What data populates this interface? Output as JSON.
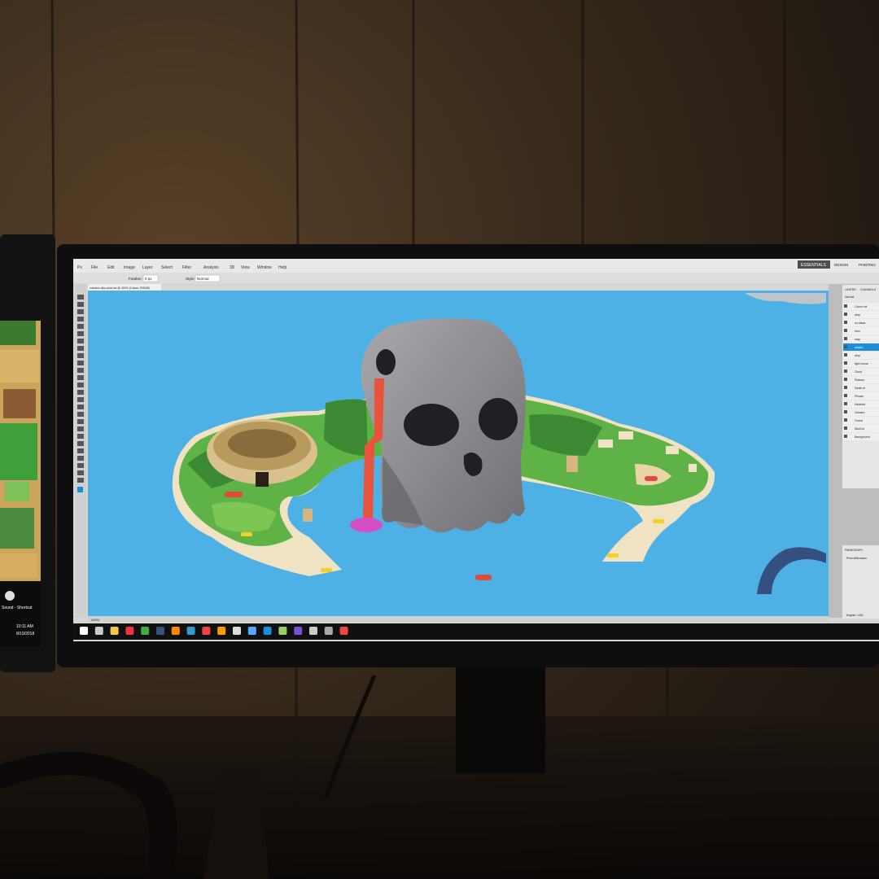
{
  "photo": {
    "wall_color": "#3a2c1e",
    "desk_color": "#120d0a"
  },
  "left_monitor": {
    "desktop_icon_label": "Sound - Shortcut",
    "taskbar_time": "10:11 AM",
    "taskbar_date": "8/19/2018"
  },
  "photoshop": {
    "menu": [
      "File",
      "Edit",
      "Image",
      "Layer",
      "Select",
      "Filter",
      "Analysis",
      "3D",
      "View",
      "Window",
      "Help"
    ],
    "workspace_tabs": [
      "ESSENTIALS",
      "DESIGN",
      "PAINTING"
    ],
    "active_workspace": "ESSENTIALS",
    "options_bar": {
      "feather_label": "Feather:",
      "feather_value": "0 px",
      "style_label": "Style:",
      "style_value": "Normal"
    },
    "doc_tab": "volcanic dino pixel art @ 400% (Colour, RGB/8)",
    "status_zoom": "400%",
    "panels": {
      "layers_tabs": [
        "LAYERS",
        "CHANNELS"
      ],
      "blend_mode": "Normal",
      "layers": [
        "Colour ref",
        "drop",
        "no ideas",
        "hero",
        "map",
        "skullsr",
        "drop",
        "light house",
        "Cloud",
        "Plateau",
        "Death M",
        "Private",
        "Haunted",
        "Volcano",
        "Forest",
        "Skull Isl",
        "Background"
      ],
      "active_layer_index": 5,
      "paragraph_tabs": [
        "PARAGRAPH",
        "CHARACTER"
      ],
      "font_name": "Pixel Millennium",
      "language": "English: USA"
    },
    "canvas_bg": "#4db1e6",
    "accent": "#1c8fd8"
  },
  "taskbar_icons": [
    "start-icon",
    "task-view-icon",
    "file-explorer-icon",
    "chrome-icon",
    "chrome-icon",
    "app-icon",
    "paint-icon",
    "app-icon",
    "app-icon",
    "vlc-icon",
    "app-icon",
    "app-icon",
    "photoshop-icon",
    "notepad-icon",
    "visual-studio-icon",
    "obs-icon",
    "steam-icon",
    "app-icon"
  ]
}
